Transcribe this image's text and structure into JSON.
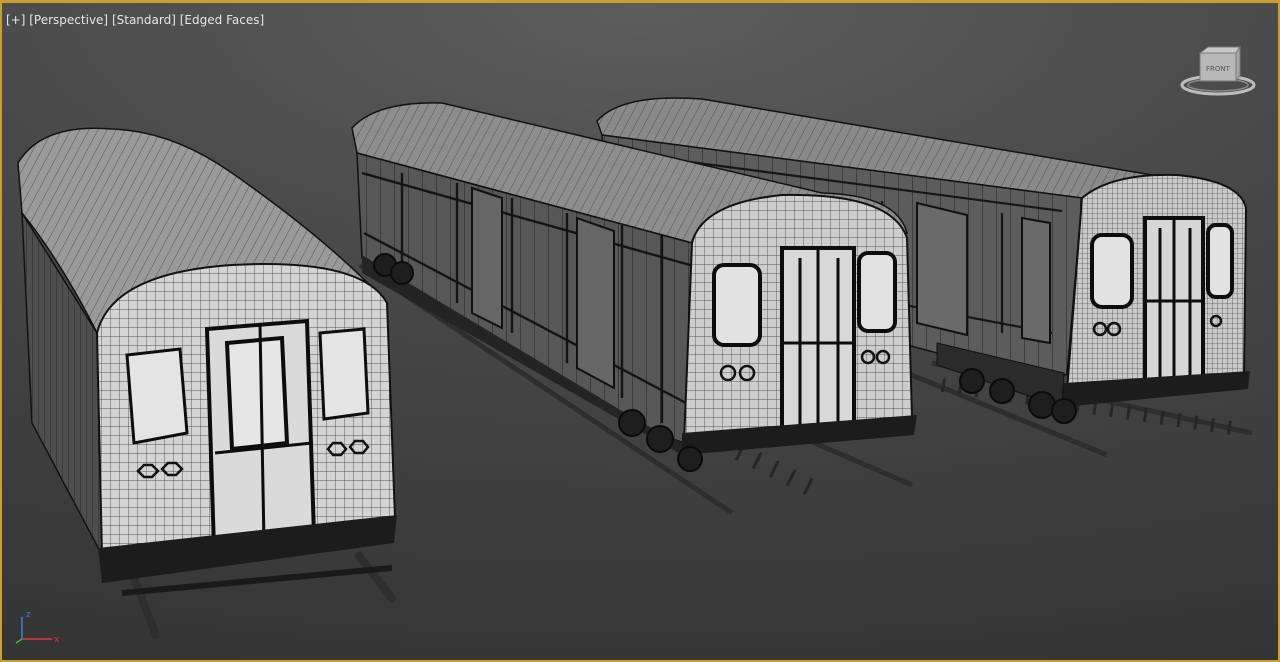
{
  "viewport": {
    "labels": {
      "plus": "[+]",
      "view": "[Perspective]",
      "shading": "[Standard]",
      "edged": "[Edged Faces]"
    }
  },
  "viewcube": {
    "face": "FRONT",
    "icon": "viewcube-icon"
  },
  "axis_tripod": {
    "x": "x",
    "z": "z",
    "colors": {
      "x": "#d83b3b",
      "z": "#3c7fe0"
    }
  },
  "scene": {
    "objects": [
      "subway-car-front-left",
      "subway-car-middle",
      "subway-car-back-right"
    ],
    "colors": {
      "panel": "#d2d2d2",
      "window": "#e2e2e2",
      "wire": "#111111",
      "side": "#595959",
      "roof": "#8a8a8a",
      "rail": "#303030"
    }
  }
}
